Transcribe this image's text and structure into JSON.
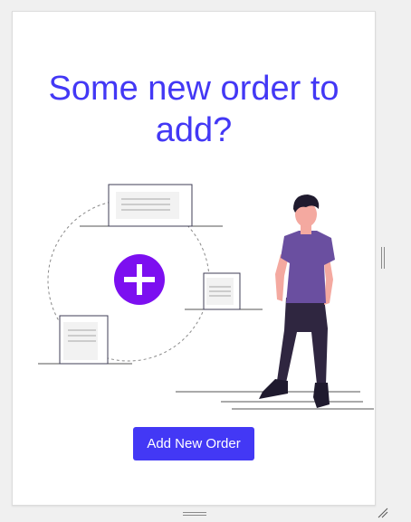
{
  "card": {
    "heading": "Some new order to add?",
    "illustration_icon": "add-circle-icon",
    "button_label": "Add New Order"
  },
  "colors": {
    "accent": "#4338f5",
    "plus_circle": "#7c0ff0",
    "shirt": "#6a4fa0",
    "pants": "#2f2640",
    "skin": "#f4a9a0",
    "hair": "#1f1a2e"
  }
}
